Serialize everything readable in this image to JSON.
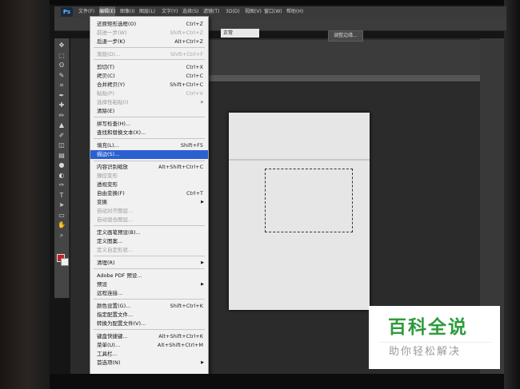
{
  "app": {
    "logo": "Ps",
    "menubar": [
      "文件(F)",
      "编辑(E)",
      "图像(I)",
      "图层(L)",
      "文字(Y)",
      "选择(S)",
      "滤镜(T)",
      "3D(D)",
      "视图(V)",
      "窗口(W)",
      "帮助(H)"
    ],
    "options": {
      "style_value": "正常",
      "refine_edge_label": "调整边缘..."
    }
  },
  "tools": [
    "move-icon",
    "marquee-icon",
    "lasso-icon",
    "quick-select-icon",
    "crop-icon",
    "eyedropper-icon",
    "healing-icon",
    "brush-icon",
    "stamp-icon",
    "history-brush-icon",
    "eraser-icon",
    "gradient-icon",
    "blur-icon",
    "dodge-icon",
    "pen-icon",
    "type-icon",
    "path-select-icon",
    "shape-icon",
    "hand-icon",
    "zoom-icon"
  ],
  "tool_glyphs": [
    "✥",
    "⬚",
    "ʘ",
    "✎",
    "⌗",
    "✒",
    "✚",
    "✏",
    "▲",
    "✐",
    "◫",
    "▤",
    "●",
    "◐",
    "✑",
    "T",
    "➤",
    "▭",
    "✋",
    "⌕"
  ],
  "colors": {
    "foreground": "#c1202b",
    "background": "#f0f0f0",
    "menu_highlight": "#2c5fd2",
    "watermark_green": "#2e9b3c"
  },
  "edit_menu": {
    "items": [
      {
        "label": "还原矩形选框(O)",
        "shortcut": "Ctrl+Z",
        "disabled": false
      },
      {
        "label": "前进一步(W)",
        "shortcut": "Shift+Ctrl+Z",
        "disabled": true
      },
      {
        "label": "后退一步(K)",
        "shortcut": "Alt+Ctrl+Z",
        "disabled": false
      },
      {
        "label": "渐隐(D)...",
        "shortcut": "Shift+Ctrl+F",
        "disabled": true
      },
      {
        "label": "剪切(T)",
        "shortcut": "Ctrl+X",
        "disabled": false
      },
      {
        "label": "拷贝(C)",
        "shortcut": "Ctrl+C",
        "disabled": false
      },
      {
        "label": "合并拷贝(Y)",
        "shortcut": "Shift+Ctrl+C",
        "disabled": false
      },
      {
        "label": "粘贴(P)",
        "shortcut": "Ctrl+V",
        "disabled": true
      },
      {
        "label": "选择性粘贴(I)",
        "shortcut": "",
        "disabled": true,
        "submenu": true
      },
      {
        "label": "清除(E)",
        "shortcut": "",
        "disabled": false
      },
      {
        "label": "拼写检查(H)...",
        "shortcut": "",
        "disabled": false
      },
      {
        "label": "查找和替换文本(X)...",
        "shortcut": "",
        "disabled": false
      },
      {
        "label": "填充(L)...",
        "shortcut": "Shift+F5",
        "disabled": false
      },
      {
        "label": "描边(S)...",
        "shortcut": "",
        "disabled": false,
        "highlighted": true
      },
      {
        "label": "内容识别缩放",
        "shortcut": "Alt+Shift+Ctrl+C",
        "disabled": false
      },
      {
        "label": "操控变形",
        "shortcut": "",
        "disabled": true
      },
      {
        "label": "透视变形",
        "shortcut": "",
        "disabled": false
      },
      {
        "label": "自由变换(F)",
        "shortcut": "Ctrl+T",
        "disabled": false
      },
      {
        "label": "变换",
        "shortcut": "",
        "disabled": false,
        "submenu": true
      },
      {
        "label": "自动对齐图层...",
        "shortcut": "",
        "disabled": true
      },
      {
        "label": "自动混合图层...",
        "shortcut": "",
        "disabled": true
      },
      {
        "label": "定义画笔预设(B)...",
        "shortcut": "",
        "disabled": false
      },
      {
        "label": "定义图案...",
        "shortcut": "",
        "disabled": false
      },
      {
        "label": "定义自定形状...",
        "shortcut": "",
        "disabled": true
      },
      {
        "label": "清理(R)",
        "shortcut": "",
        "disabled": false,
        "submenu": true
      },
      {
        "label": "Adobe PDF 预设...",
        "shortcut": "",
        "disabled": false
      },
      {
        "label": "预设",
        "shortcut": "",
        "disabled": false,
        "submenu": true
      },
      {
        "label": "远程连接...",
        "shortcut": "",
        "disabled": false
      },
      {
        "label": "颜色设置(G)...",
        "shortcut": "Shift+Ctrl+K",
        "disabled": false
      },
      {
        "label": "指定配置文件...",
        "shortcut": "",
        "disabled": false
      },
      {
        "label": "转换为配置文件(V)...",
        "shortcut": "",
        "disabled": false
      },
      {
        "label": "键盘快捷键...",
        "shortcut": "Alt+Shift+Ctrl+K",
        "disabled": false
      },
      {
        "label": "菜单(U)...",
        "shortcut": "Alt+Shift+Ctrl+M",
        "disabled": false
      },
      {
        "label": "工具栏...",
        "shortcut": "",
        "disabled": false
      },
      {
        "label": "首选项(N)",
        "shortcut": "",
        "disabled": false,
        "submenu": true
      }
    ]
  },
  "watermark": {
    "title": "百科全说",
    "subtitle": "助你轻松解决"
  }
}
